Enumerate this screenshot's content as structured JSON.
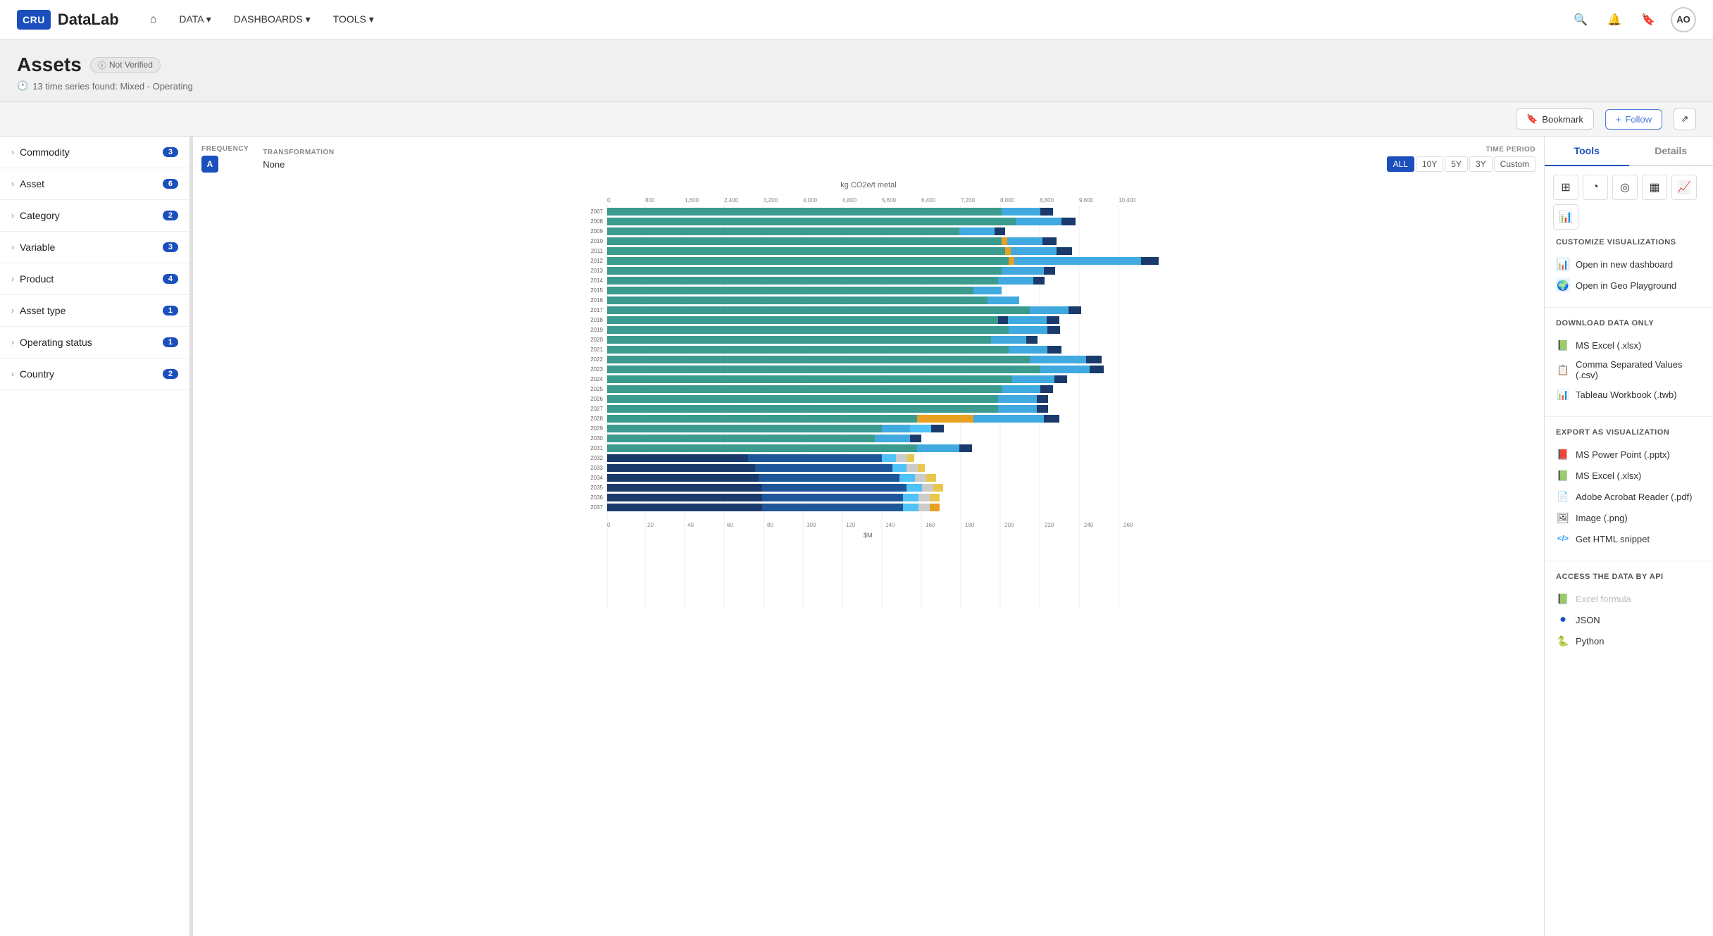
{
  "app": {
    "logo_text": "CRU",
    "app_name": "DataLab"
  },
  "navbar": {
    "home_icon": "⌂",
    "links": [
      {
        "label": "DATA",
        "has_dropdown": true
      },
      {
        "label": "DASHBOARDS",
        "has_dropdown": true
      },
      {
        "label": "TOOLS",
        "has_dropdown": true
      }
    ],
    "search_icon": "🔍",
    "bell_icon": "🔔",
    "bookmark_icon": "🔖",
    "avatar_text": "AO"
  },
  "page": {
    "title": "Assets",
    "badge": "Not Verified",
    "subtitle": "13 time series found: Mixed - Operating"
  },
  "actions": {
    "bookmark_label": "Bookmark",
    "follow_label": "Follow",
    "share_icon": "share"
  },
  "filters": [
    {
      "label": "Commodity",
      "count": 3
    },
    {
      "label": "Asset",
      "count": 6
    },
    {
      "label": "Category",
      "count": 2
    },
    {
      "label": "Variable",
      "count": 3
    },
    {
      "label": "Product",
      "count": 4
    },
    {
      "label": "Asset type",
      "count": 1
    },
    {
      "label": "Operating status",
      "count": 1
    },
    {
      "label": "Country",
      "count": 2
    }
  ],
  "chart": {
    "frequency_label": "FREQUENCY",
    "frequency_value": "A",
    "transformation_label": "TRANSFORMATION",
    "transformation_value": "None",
    "time_period_label": "TIME PERIOD",
    "time_period_buttons": [
      "ALL",
      "10Y",
      "5Y",
      "3Y",
      "Custom"
    ],
    "active_time_period": "ALL",
    "y_axis_label": "kg CO2e/t metal",
    "x_axis_label": "$M",
    "top_grid_values": [
      "0",
      "800",
      "1,600",
      "2,400",
      "3,200",
      "4,000",
      "4,800",
      "5,600",
      "6,400",
      "7,200",
      "8,000",
      "8,800",
      "9,600",
      "10,400"
    ],
    "bottom_grid_values": [
      "0",
      "20",
      "40",
      "60",
      "80",
      "100",
      "120",
      "140",
      "160",
      "180",
      "200",
      "220",
      "240",
      "260"
    ],
    "years": [
      "2007",
      "2008",
      "2009",
      "2010",
      "2011",
      "2012",
      "2013",
      "2014",
      "2015",
      "2016",
      "2017",
      "2018",
      "2019",
      "2020",
      "2021",
      "2022",
      "2023",
      "2024",
      "2025",
      "2026",
      "2027",
      "2028",
      "2029",
      "2030",
      "2031",
      "2032",
      "2033",
      "2034",
      "2035",
      "2036",
      "2037"
    ]
  },
  "tools": {
    "tabs": [
      "Tools",
      "Details"
    ],
    "active_tab": "Tools",
    "customize_section": "CUSTOMIZE VISUALIZATIONS",
    "customize_items": [
      {
        "label": "Open in new dashboard",
        "icon": "📊"
      },
      {
        "label": "Open in Geo Playground",
        "icon": "🌍"
      }
    ],
    "download_section": "DOWNLOAD DATA ONLY",
    "download_items": [
      {
        "label": "MS Excel (.xlsx)",
        "icon": "📗"
      },
      {
        "label": "Comma Separated Values (.csv)",
        "icon": "📋"
      },
      {
        "label": "Tableau Workbook (.twb)",
        "icon": "📊"
      }
    ],
    "export_section": "EXPORT AS VISUALIZATION",
    "export_items": [
      {
        "label": "MS Power Point (.pptx)",
        "icon": "📕"
      },
      {
        "label": "MS Excel (.xlsx)",
        "icon": "📗"
      },
      {
        "label": "Adobe Acrobat Reader (.pdf)",
        "icon": "📄"
      },
      {
        "label": "Image (.png)",
        "icon": "🖼"
      },
      {
        "label": "Get HTML snippet",
        "icon": "⟨⟩"
      }
    ],
    "api_section": "ACCESS THE DATA BY API",
    "api_items": [
      {
        "label": "Excel formula",
        "icon": "📗",
        "grayed": true
      },
      {
        "label": "JSON",
        "icon": "●"
      },
      {
        "label": "Python",
        "icon": "🐍"
      }
    ]
  }
}
